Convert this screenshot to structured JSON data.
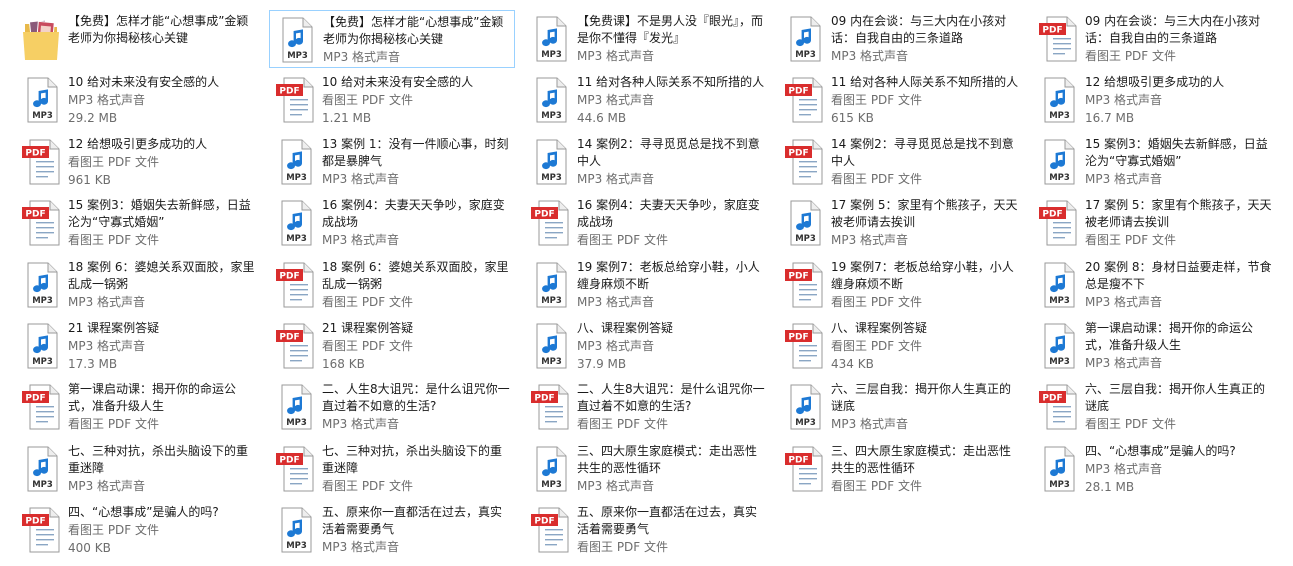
{
  "explorer": {
    "columns": 5,
    "rows": 9,
    "files": [
      {
        "name": "【免费】怎样才能“心想事成”金颖老师为你揭秘核心关键",
        "type": "",
        "size": "",
        "icon": "folder-image-icon"
      },
      {
        "name": "【免费】怎样才能“心想事成”金颖老师为你揭秘核心关键",
        "type": "MP3 格式声音",
        "size": "",
        "icon": "mp3-file-icon",
        "selected": true
      },
      {
        "name": "【免费课】不是男人没『眼光』，而是你不懂得『发光』",
        "type": "MP3 格式声音",
        "size": "",
        "icon": "mp3-file-icon"
      },
      {
        "name": "09 内在会谈：与三大内在小孩对话：自我自由的三条道路",
        "type": "MP3 格式声音",
        "size": "",
        "icon": "mp3-file-icon"
      },
      {
        "name": "09 内在会谈：与三大内在小孩对话：自我自由的三条道路",
        "type": "看图王 PDF 文件",
        "size": "",
        "icon": "pdf-file-icon"
      },
      {
        "name": "10 给对未来没有安全感的人",
        "type": "MP3 格式声音",
        "size": "29.2 MB",
        "icon": "mp3-file-icon"
      },
      {
        "name": "10 给对未来没有安全感的人",
        "type": "看图王 PDF 文件",
        "size": "1.21 MB",
        "icon": "pdf-file-icon"
      },
      {
        "name": "11 给对各种人际关系不知所措的人",
        "type": "MP3 格式声音",
        "size": "44.6 MB",
        "icon": "mp3-file-icon"
      },
      {
        "name": "11 给对各种人际关系不知所措的人",
        "type": "看图王 PDF 文件",
        "size": "615 KB",
        "icon": "pdf-file-icon"
      },
      {
        "name": "12 给想吸引更多成功的人",
        "type": "MP3 格式声音",
        "size": "16.7 MB",
        "icon": "mp3-file-icon"
      },
      {
        "name": "12 给想吸引更多成功的人",
        "type": "看图王 PDF 文件",
        "size": "961 KB",
        "icon": "pdf-file-icon"
      },
      {
        "name": "13 案例 1：没有一件顺心事，时刻都是暴脾气",
        "type": "MP3 格式声音",
        "size": "",
        "icon": "mp3-file-icon"
      },
      {
        "name": "14 案例2：寻寻觅觅总是找不到意中人",
        "type": "MP3 格式声音",
        "size": "",
        "icon": "mp3-file-icon"
      },
      {
        "name": "14 案例2：寻寻觅觅总是找不到意中人",
        "type": "看图王 PDF 文件",
        "size": "",
        "icon": "pdf-file-icon"
      },
      {
        "name": "15 案例3：婚姻失去新鲜感，日益沦为“守寡式婚姻”",
        "type": "MP3 格式声音",
        "size": "",
        "icon": "mp3-file-icon"
      },
      {
        "name": "15 案例3：婚姻失去新鲜感，日益沦为“守寡式婚姻”",
        "type": "看图王 PDF 文件",
        "size": "",
        "icon": "pdf-file-icon"
      },
      {
        "name": "16 案例4：夫妻天天争吵，家庭变成战场",
        "type": "MP3 格式声音",
        "size": "",
        "icon": "mp3-file-icon"
      },
      {
        "name": "16 案例4：夫妻天天争吵，家庭变成战场",
        "type": "看图王 PDF 文件",
        "size": "",
        "icon": "pdf-file-icon"
      },
      {
        "name": "17 案例 5：家里有个熊孩子，天天被老师请去挨训",
        "type": "MP3 格式声音",
        "size": "",
        "icon": "mp3-file-icon"
      },
      {
        "name": "17 案例 5：家里有个熊孩子，天天被老师请去挨训",
        "type": "看图王 PDF 文件",
        "size": "",
        "icon": "pdf-file-icon"
      },
      {
        "name": "18 案例 6：婆媳关系双面胶，家里乱成一锅粥",
        "type": "MP3 格式声音",
        "size": "",
        "icon": "mp3-file-icon"
      },
      {
        "name": "18 案例 6：婆媳关系双面胶，家里乱成一锅粥",
        "type": "看图王 PDF 文件",
        "size": "",
        "icon": "pdf-file-icon"
      },
      {
        "name": "19 案例7：老板总给穿小鞋，小人缠身麻烦不断",
        "type": "MP3 格式声音",
        "size": "",
        "icon": "mp3-file-icon"
      },
      {
        "name": "19 案例7：老板总给穿小鞋，小人缠身麻烦不断",
        "type": "看图王 PDF 文件",
        "size": "",
        "icon": "pdf-file-icon"
      },
      {
        "name": "20 案例 8：身材日益要走样，节食总是瘦不下",
        "type": "MP3 格式声音",
        "size": "",
        "icon": "mp3-file-icon"
      },
      {
        "name": "21 课程案例答疑",
        "type": "MP3 格式声音",
        "size": "17.3 MB",
        "icon": "mp3-file-icon"
      },
      {
        "name": "21 课程案例答疑",
        "type": "看图王 PDF 文件",
        "size": "168 KB",
        "icon": "pdf-file-icon"
      },
      {
        "name": "八、课程案例答疑",
        "type": "MP3 格式声音",
        "size": "37.9 MB",
        "icon": "mp3-file-icon"
      },
      {
        "name": "八、课程案例答疑",
        "type": "看图王 PDF 文件",
        "size": "434 KB",
        "icon": "pdf-file-icon"
      },
      {
        "name": "第一课启动课：揭开你的命运公式，准备升级人生",
        "type": "MP3 格式声音",
        "size": "",
        "icon": "mp3-file-icon"
      },
      {
        "name": "第一课启动课：揭开你的命运公式，准备升级人生",
        "type": "看图王 PDF 文件",
        "size": "",
        "icon": "pdf-file-icon"
      },
      {
        "name": "二、人生8大诅咒：是什么诅咒你一直过着不如意的生活?",
        "type": "MP3 格式声音",
        "size": "",
        "icon": "mp3-file-icon"
      },
      {
        "name": "二、人生8大诅咒：是什么诅咒你一直过着不如意的生活?",
        "type": "看图王 PDF 文件",
        "size": "",
        "icon": "pdf-file-icon"
      },
      {
        "name": "六、三层自我：揭开你人生真正的谜底",
        "type": "MP3 格式声音",
        "size": "",
        "icon": "mp3-file-icon"
      },
      {
        "name": "六、三层自我：揭开你人生真正的谜底",
        "type": "看图王 PDF 文件",
        "size": "",
        "icon": "pdf-file-icon"
      },
      {
        "name": "七、三种对抗，杀出头脑设下的重重迷障",
        "type": "MP3 格式声音",
        "size": "",
        "icon": "mp3-file-icon"
      },
      {
        "name": "七、三种对抗，杀出头脑设下的重重迷障",
        "type": "看图王 PDF 文件",
        "size": "",
        "icon": "pdf-file-icon"
      },
      {
        "name": "三、四大原生家庭模式：走出恶性共生的恶性循环",
        "type": "MP3 格式声音",
        "size": "",
        "icon": "mp3-file-icon"
      },
      {
        "name": "三、四大原生家庭模式：走出恶性共生的恶性循环",
        "type": "看图王 PDF 文件",
        "size": "",
        "icon": "pdf-file-icon"
      },
      {
        "name": "四、“心想事成”是骗人的吗?",
        "type": "MP3 格式声音",
        "size": "28.1 MB",
        "icon": "mp3-file-icon"
      },
      {
        "name": "四、“心想事成”是骗人的吗?",
        "type": "看图王 PDF 文件",
        "size": "400 KB",
        "icon": "pdf-file-icon"
      },
      {
        "name": "五、原来你一直都活在过去，真实活着需要勇气",
        "type": "MP3 格式声音",
        "size": "",
        "icon": "mp3-file-icon"
      },
      {
        "name": "五、原来你一直都活在过去，真实活着需要勇气",
        "type": "看图王 PDF 文件",
        "size": "",
        "icon": "pdf-file-icon"
      }
    ],
    "icon_labels": {
      "mp3": "MP3",
      "pdf": "PDF"
    },
    "colors": {
      "note_blue": "#1d79d4",
      "pdf_red": "#d92d2d",
      "selection_border": "#99d1ff",
      "meta_gray": "#6d6d6d"
    }
  }
}
